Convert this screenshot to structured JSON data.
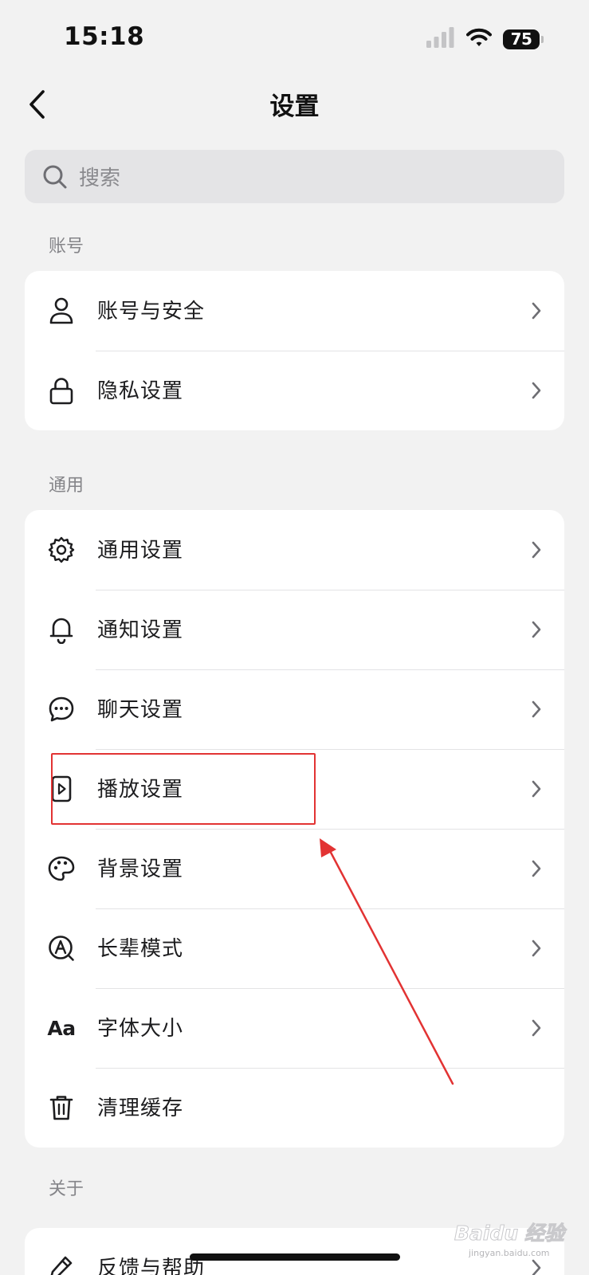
{
  "status_bar": {
    "time": "15:18",
    "battery": "75",
    "signal_icon": "cellular-signal-icon",
    "wifi_icon": "wifi-icon"
  },
  "nav": {
    "title": "设置",
    "back_icon": "chevron-left-icon"
  },
  "search": {
    "placeholder": "搜索",
    "icon": "search-icon"
  },
  "sections": [
    {
      "title": "账号",
      "items": [
        {
          "label": "账号与安全",
          "icon": "user-icon"
        },
        {
          "label": "隐私设置",
          "icon": "lock-icon"
        }
      ]
    },
    {
      "title": "通用",
      "items": [
        {
          "label": "通用设置",
          "icon": "gear-icon"
        },
        {
          "label": "通知设置",
          "icon": "bell-icon"
        },
        {
          "label": "聊天设置",
          "icon": "chat-bubble-icon"
        },
        {
          "label": "播放设置",
          "icon": "play-file-icon"
        },
        {
          "label": "背景设置",
          "icon": "palette-icon"
        },
        {
          "label": "长辈模式",
          "icon": "elder-mode-icon"
        },
        {
          "label": "字体大小",
          "icon": "font-size-icon",
          "icon_text": "Aa"
        },
        {
          "label": "清理缓存",
          "icon": "trash-icon"
        }
      ]
    },
    {
      "title": "关于",
      "items": [
        {
          "label": "反馈与帮助",
          "icon": "pencil-icon"
        }
      ]
    }
  ],
  "annotation": {
    "color": "#e23333"
  },
  "watermark": {
    "brand": "Baidu",
    "product": "经验",
    "url": "jingyan.baidu.com"
  }
}
